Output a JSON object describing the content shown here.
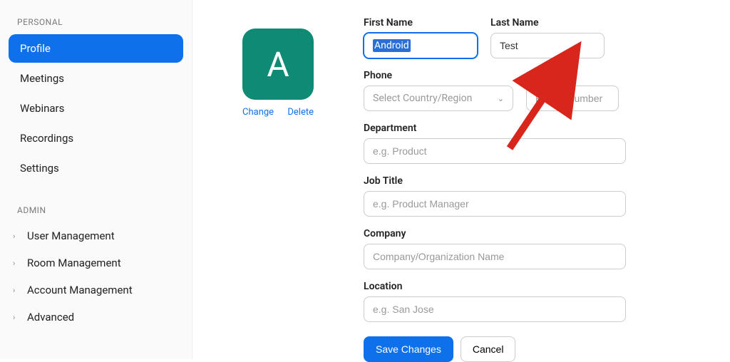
{
  "sidebar": {
    "personal_label": "PERSONAL",
    "items": [
      {
        "label": "Profile",
        "active": true
      },
      {
        "label": "Meetings",
        "active": false
      },
      {
        "label": "Webinars",
        "active": false
      },
      {
        "label": "Recordings",
        "active": false
      },
      {
        "label": "Settings",
        "active": false
      }
    ],
    "admin_label": "ADMIN",
    "admin_items": [
      {
        "label": "User Management"
      },
      {
        "label": "Room Management"
      },
      {
        "label": "Account Management"
      },
      {
        "label": "Advanced"
      }
    ]
  },
  "avatar": {
    "letter": "A",
    "change": "Change",
    "delete": "Delete"
  },
  "form": {
    "first_name_label": "First Name",
    "first_name_value": "Android",
    "last_name_label": "Last Name",
    "last_name_value": "Test",
    "phone_label": "Phone",
    "phone_region_placeholder": "Select Country/Region",
    "phone_number_placeholder": "Phone Number",
    "department_label": "Department",
    "department_placeholder": "e.g. Product",
    "job_title_label": "Job Title",
    "job_title_placeholder": "e.g. Product Manager",
    "company_label": "Company",
    "company_placeholder": "Company/Organization Name",
    "location_label": "Location",
    "location_placeholder": "e.g. San Jose",
    "save_label": "Save Changes",
    "cancel_label": "Cancel"
  }
}
